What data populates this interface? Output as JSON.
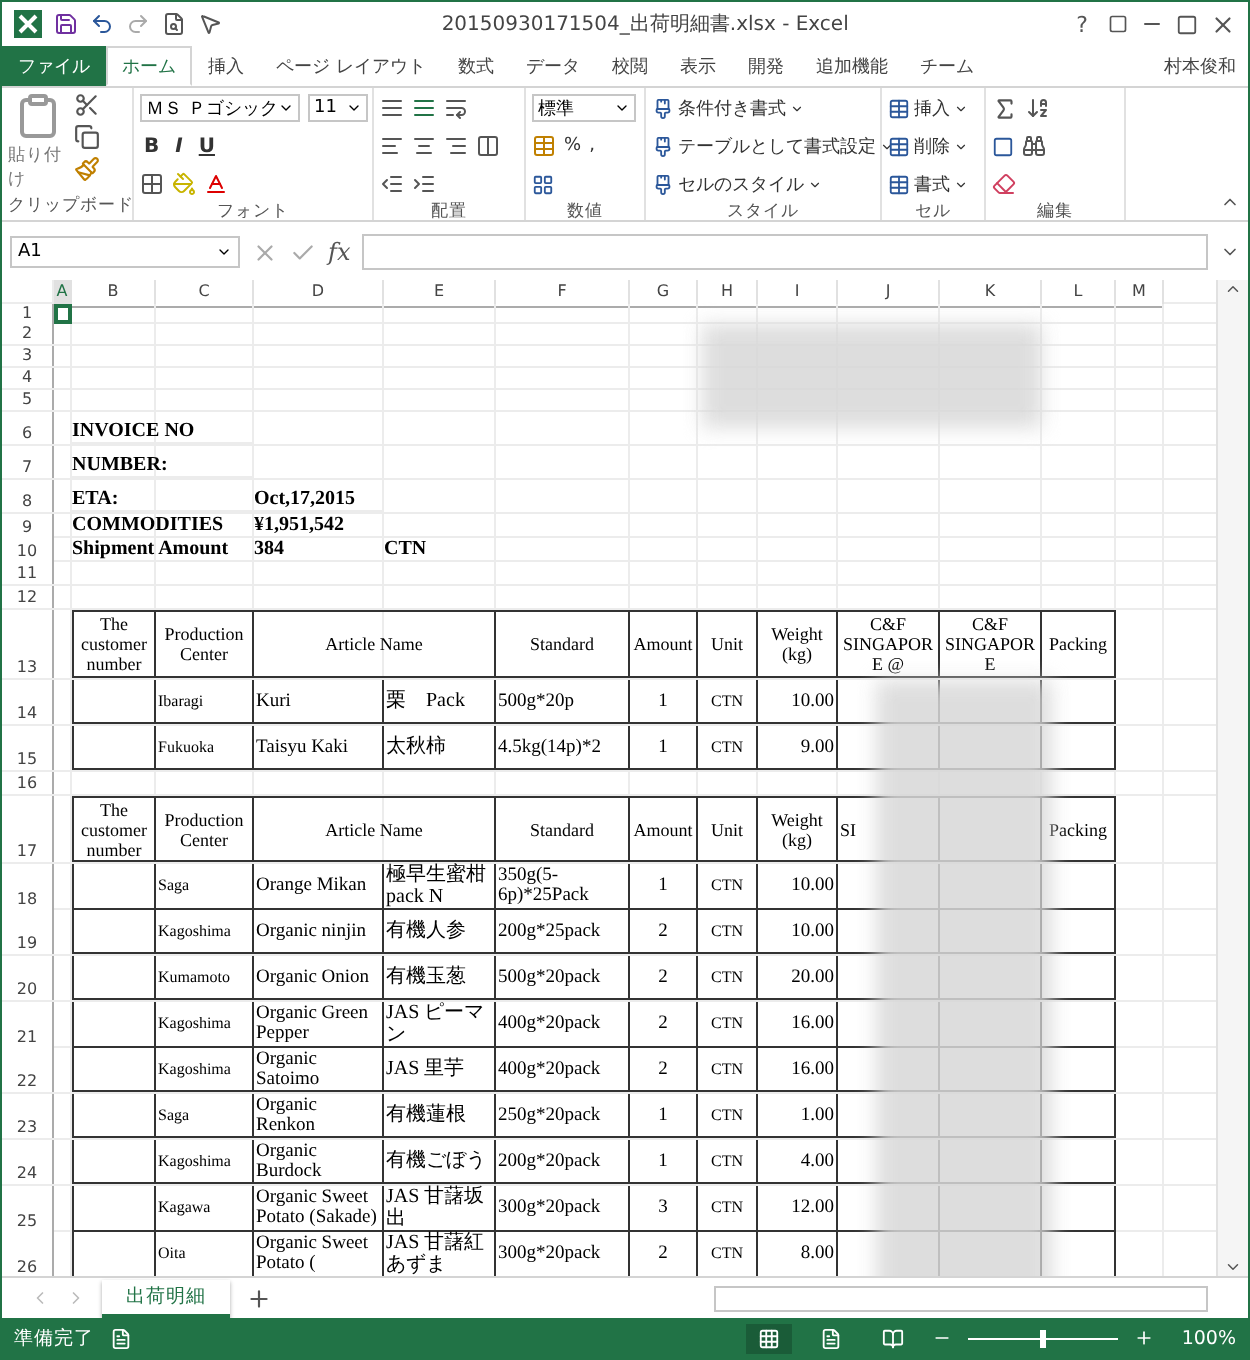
{
  "window": {
    "title": "20150930171504_出荷明細書.xlsx - Excel",
    "help": "?"
  },
  "ribbon_tabs": [
    {
      "label": "ファイル",
      "kind": "file",
      "selected": false
    },
    {
      "label": "ホーム",
      "kind": "tab",
      "selected": true
    },
    {
      "label": "挿入",
      "kind": "tab",
      "selected": false
    },
    {
      "label": "ページ レイアウト",
      "kind": "tab",
      "selected": false
    },
    {
      "label": "数式",
      "kind": "tab",
      "selected": false
    },
    {
      "label": "データ",
      "kind": "tab",
      "selected": false
    },
    {
      "label": "校閲",
      "kind": "tab",
      "selected": false
    },
    {
      "label": "表示",
      "kind": "tab",
      "selected": false
    },
    {
      "label": "開発",
      "kind": "tab",
      "selected": false
    },
    {
      "label": "追加機能",
      "kind": "tab",
      "selected": false
    },
    {
      "label": "チーム",
      "kind": "tab",
      "selected": false
    }
  ],
  "user": "村本俊和",
  "ribbon": {
    "clipboard": {
      "paste": "貼り付け",
      "label": "クリップボード"
    },
    "font": {
      "name": "ＭＳ Ｐゴシック",
      "size": "11",
      "bold": "B",
      "italic": "I",
      "underline": "U",
      "label": "フォント"
    },
    "alignment": {
      "label": "配置"
    },
    "number": {
      "format": "標準",
      "percent": "%",
      "comma": ",",
      "label": "数値"
    },
    "styles": {
      "items": [
        "条件付き書式",
        "テーブルとして書式設定",
        "セルのスタイル"
      ],
      "label": "スタイル"
    },
    "cells": {
      "items": [
        "挿入",
        "削除",
        "書式"
      ],
      "label": "セル"
    },
    "editing": {
      "label": "編集"
    }
  },
  "formula_bar": {
    "name_box": "A1",
    "function_label": "fx"
  },
  "columns": [
    {
      "label": "A",
      "selected": true
    },
    {
      "label": "B",
      "selected": false
    },
    {
      "label": "C",
      "selected": false
    },
    {
      "label": "D",
      "selected": false
    },
    {
      "label": "E",
      "selected": false
    },
    {
      "label": "F",
      "selected": false
    },
    {
      "label": "G",
      "selected": false
    },
    {
      "label": "H",
      "selected": false
    },
    {
      "label": "I",
      "selected": false
    },
    {
      "label": "J",
      "selected": false
    },
    {
      "label": "K",
      "selected": false
    },
    {
      "label": "L",
      "selected": false
    },
    {
      "label": "M",
      "selected": false
    }
  ],
  "rows": [
    {
      "number": "1",
      "kind": "blank",
      "cursor": true
    },
    {
      "number": "2",
      "kind": "blank"
    },
    {
      "number": "3",
      "kind": "blank"
    },
    {
      "number": "4",
      "kind": "blank"
    },
    {
      "number": "5",
      "kind": "blank"
    },
    {
      "number": "6",
      "kind": "info",
      "label": "INVOICE NO"
    },
    {
      "number": "7",
      "kind": "info",
      "label": "NUMBER:"
    },
    {
      "number": "8",
      "kind": "info",
      "label": "ETA:",
      "value": "Oct,17,2015"
    },
    {
      "number": "9",
      "kind": "info",
      "label": "COMMODITIES",
      "value": "¥1,951,542"
    },
    {
      "number": "10",
      "kind": "info",
      "label": "Shipment  Amount",
      "value": "384",
      "count_unit": "CTN"
    },
    {
      "number": "11",
      "kind": "blank"
    },
    {
      "number": "12",
      "kind": "blank"
    },
    {
      "number": "13",
      "kind": "header",
      "customer": "The customer number",
      "center": "Production Center",
      "article": "Article  Name",
      "standard": "Standard",
      "amount": "Amount",
      "unit": "Unit",
      "weight": "Weight (kg)",
      "cf_at": "C&F SINGAPORE @",
      "cf": "C&F SINGAPORE",
      "packing": "Packing"
    },
    {
      "number": "14",
      "kind": "item",
      "center": "Ibaragi",
      "article_en": "Kuri",
      "article_ja": "栗　Pack",
      "standard": "500g*20p",
      "amount": "1",
      "unit": "CTN",
      "weight": "10.00"
    },
    {
      "number": "15",
      "kind": "item",
      "center": "Fukuoka",
      "article_en": "Taisyu Kaki",
      "article_ja": "太秋柿",
      "standard": "4.5kg(14p)*2",
      "amount": "1",
      "unit": "CTN",
      "weight": "9.00"
    },
    {
      "number": "16",
      "kind": "blank"
    },
    {
      "number": "17",
      "kind": "header",
      "customer": "The customer number",
      "center": "Production Center",
      "article": "Article  Name",
      "standard": "Standard",
      "amount": "Amount",
      "unit": "Unit",
      "weight": "Weight (kg)",
      "cf_at": "SI",
      "packing": "Packing"
    },
    {
      "number": "18",
      "kind": "item",
      "center": "Saga",
      "article_en": "Orange Mikan",
      "article_ja": "極早生蜜柑 pack N",
      "standard": "350g(5-6p)*25Pack",
      "amount": "1",
      "unit": "CTN",
      "weight": "10.00"
    },
    {
      "number": "19",
      "kind": "item",
      "center": "Kagoshima",
      "article_en": "Organic ninjin",
      "article_ja": "有機人参",
      "standard": "200g*25pack",
      "amount": "2",
      "unit": "CTN",
      "weight": "10.00"
    },
    {
      "number": "20",
      "kind": "item",
      "center": "Kumamoto",
      "article_en": "Organic Onion",
      "article_ja": "有機玉葱",
      "standard": "500g*20pack",
      "amount": "2",
      "unit": "CTN",
      "weight": "20.00"
    },
    {
      "number": "21",
      "kind": "item",
      "center": "Kagoshima",
      "article_en": "Organic Green Pepper",
      "article_ja": "JAS ピーマン",
      "standard": "400g*20pack",
      "amount": "2",
      "unit": "CTN",
      "weight": "16.00"
    },
    {
      "number": "22",
      "kind": "item",
      "center": "Kagoshima",
      "article_en": "Organic Satoimo",
      "article_ja": "JAS 里芋",
      "standard": "400g*20pack",
      "amount": "2",
      "unit": "CTN",
      "weight": "16.00"
    },
    {
      "number": "23",
      "kind": "item",
      "center": "Saga",
      "article_en": "Organic Renkon",
      "article_ja": "有機蓮根",
      "standard": "250g*20pack",
      "amount": "1",
      "unit": "CTN",
      "weight": "1.00"
    },
    {
      "number": "24",
      "kind": "item",
      "center": "Kagoshima",
      "article_en": "Organic Burdock",
      "article_ja": "有機ごぼう",
      "standard": "200g*20pack",
      "amount": "1",
      "unit": "CTN",
      "weight": "4.00"
    },
    {
      "number": "25",
      "kind": "item",
      "center": "Kagawa",
      "article_en": "Organic Sweet Potato (Sakade)",
      "article_ja": "JAS 甘藷坂出",
      "standard": "300g*20pack",
      "amount": "3",
      "unit": "CTN",
      "weight": "12.00"
    },
    {
      "number": "26",
      "kind": "item",
      "center": "Oita",
      "article_en": "Organic Sweet Potato (",
      "article_ja": "JAS 甘藷紅あずま",
      "standard": "300g*20pack",
      "amount": "2",
      "unit": "CTN",
      "weight": "8.00"
    }
  ],
  "sheet_tabs": [
    {
      "label": "出荷明細",
      "selected": true
    }
  ],
  "status_bar": {
    "status": "準備完了",
    "views": [
      {
        "kind": "normal",
        "selected": true
      },
      {
        "kind": "layout",
        "selected": false
      },
      {
        "kind": "pagebreak",
        "selected": false
      }
    ],
    "zoom": {
      "level": 0.5,
      "reading": "100%"
    }
  }
}
